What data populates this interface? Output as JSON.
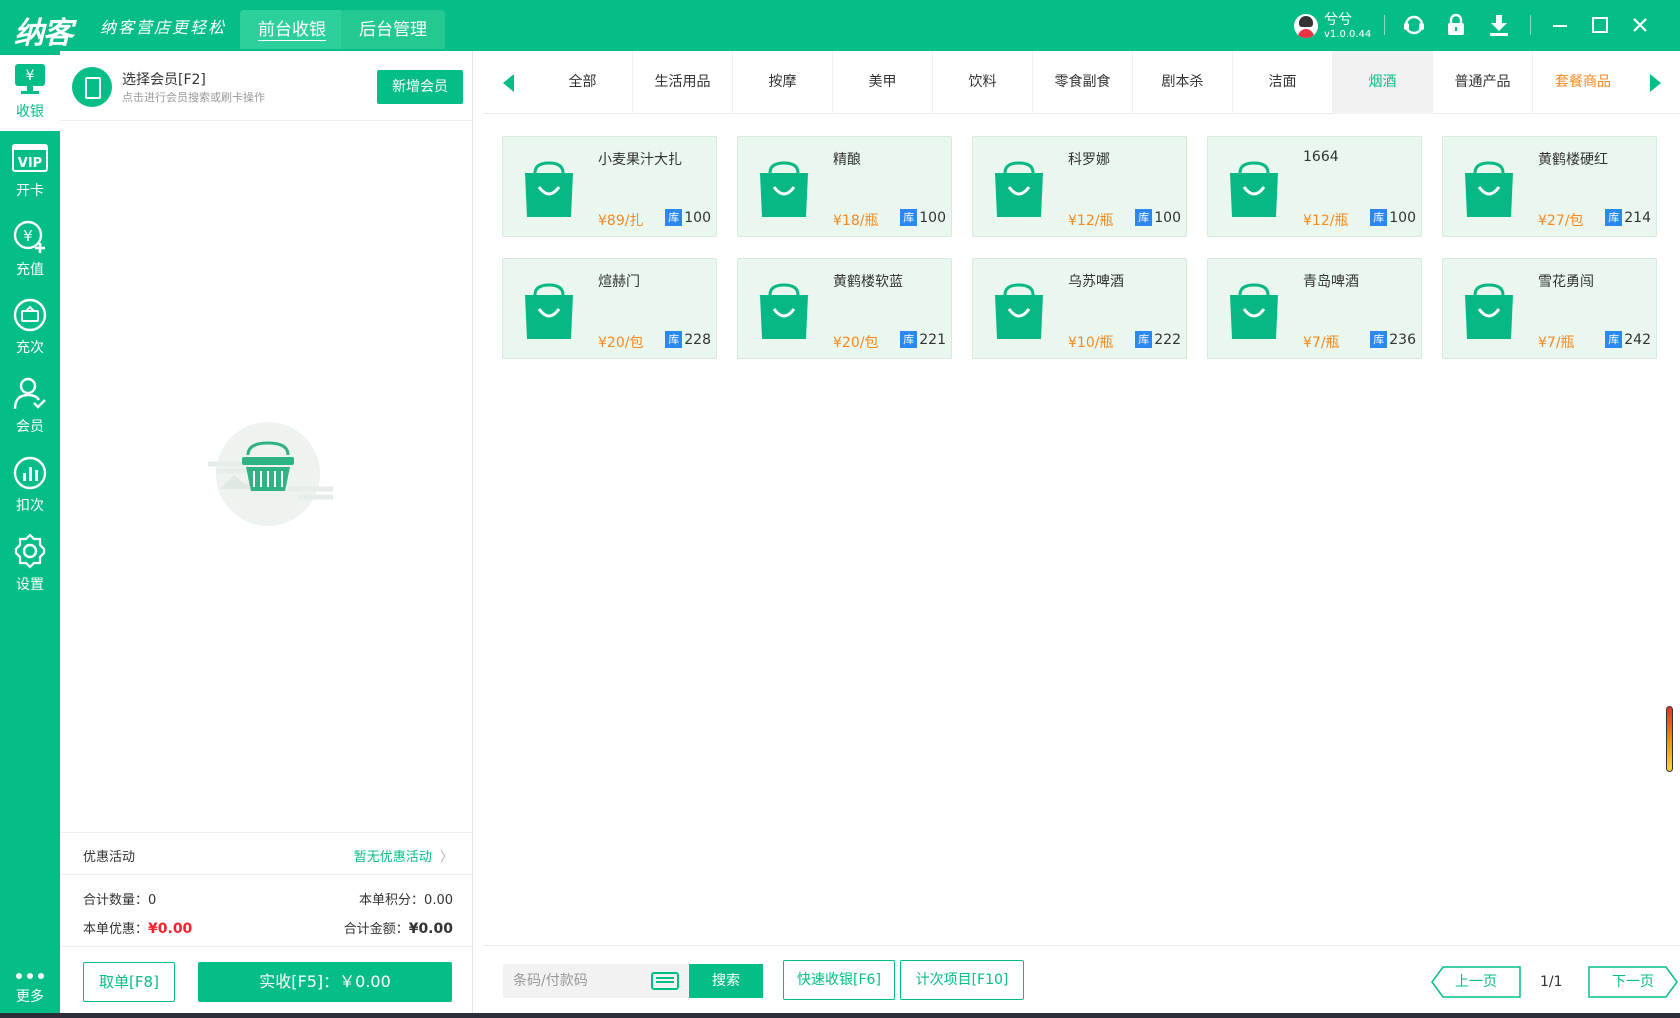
{
  "app": {
    "logo": "纳客",
    "slogan": "纳客营店更轻松",
    "tabs": [
      {
        "label": "前台收银",
        "active": true
      },
      {
        "label": "后台管理",
        "active": false
      }
    ],
    "user": {
      "name": "兮兮",
      "version": "v1.0.0.44"
    }
  },
  "sidebar": {
    "items": [
      {
        "label": "收银",
        "icon": "cashier-monitor-icon",
        "active": true
      },
      {
        "label": "开卡",
        "icon": "vip-card-icon",
        "active": false
      },
      {
        "label": "充值",
        "icon": "yen-plus-icon",
        "active": false
      },
      {
        "label": "充次",
        "icon": "recharge-times-icon",
        "active": false
      },
      {
        "label": "会员",
        "icon": "member-user-icon",
        "active": false
      },
      {
        "label": "扣次",
        "icon": "bar-chart-icon",
        "active": false
      },
      {
        "label": "设置",
        "icon": "gear-icon",
        "active": false
      },
      {
        "label": "更多",
        "icon": "more-dots-icon",
        "active": false
      }
    ]
  },
  "cart": {
    "member_title": "选择会员[F2]",
    "member_sub": "点击进行会员搜索或刷卡操作",
    "add_member": "新增会员",
    "promo_label": "优惠活动",
    "promo_value": "暂无优惠活动",
    "total_qty": "合计数量：0",
    "points": "本单积分：0.00",
    "discount_label": "本单优惠：",
    "discount_value": "¥0.00",
    "total_amount_label": "合计金额：",
    "total_amount_value": "¥0.00",
    "cancel_btn": "取单[F8]",
    "pay_btn": "实收[F5]：￥0.00"
  },
  "categories": {
    "items": [
      "全部",
      "生活用品",
      "按摩",
      "美甲",
      "饮料",
      "零食副食",
      "剧本杀",
      "洁面",
      "烟酒",
      "普通产品",
      "套餐商品"
    ],
    "active_index": 8,
    "special_index": 10
  },
  "products": [
    {
      "name": "小麦果汁大扎",
      "price": "¥89/扎",
      "stock_tag": "库",
      "stock": "100"
    },
    {
      "name": "精酿",
      "price": "¥18/瓶",
      "stock_tag": "库",
      "stock": "100"
    },
    {
      "name": "科罗娜",
      "price": "¥12/瓶",
      "stock_tag": "库",
      "stock": "100"
    },
    {
      "name": "1664",
      "price": "¥12/瓶",
      "stock_tag": "库",
      "stock": "100"
    },
    {
      "name": "黄鹤楼硬红",
      "price": "¥27/包",
      "stock_tag": "库",
      "stock": "214"
    },
    {
      "name": "煊赫门",
      "price": "¥20/包",
      "stock_tag": "库",
      "stock": "228"
    },
    {
      "name": "黄鹤楼软蓝",
      "price": "¥20/包",
      "stock_tag": "库",
      "stock": "221"
    },
    {
      "name": "乌苏啤酒",
      "price": "¥10/瓶",
      "stock_tag": "库",
      "stock": "222"
    },
    {
      "name": "青岛啤酒",
      "price": "¥7/瓶",
      "stock_tag": "库",
      "stock": "236"
    },
    {
      "name": "雪花勇闯",
      "price": "¥7/瓶",
      "stock_tag": "库",
      "stock": "242"
    }
  ],
  "bottom": {
    "search_placeholder": "条码/付款码",
    "search_btn": "搜索",
    "quick_cash": "快速收银[F6]",
    "count_item": "计次项目[F10]",
    "prev_page": "上一页",
    "page_info": "1/1",
    "next_page": "下一页"
  },
  "colors": {
    "brand": "#05bd87",
    "price": "#f5891f",
    "stock_tag": "#2b88f0",
    "discount": "#f5222d"
  }
}
